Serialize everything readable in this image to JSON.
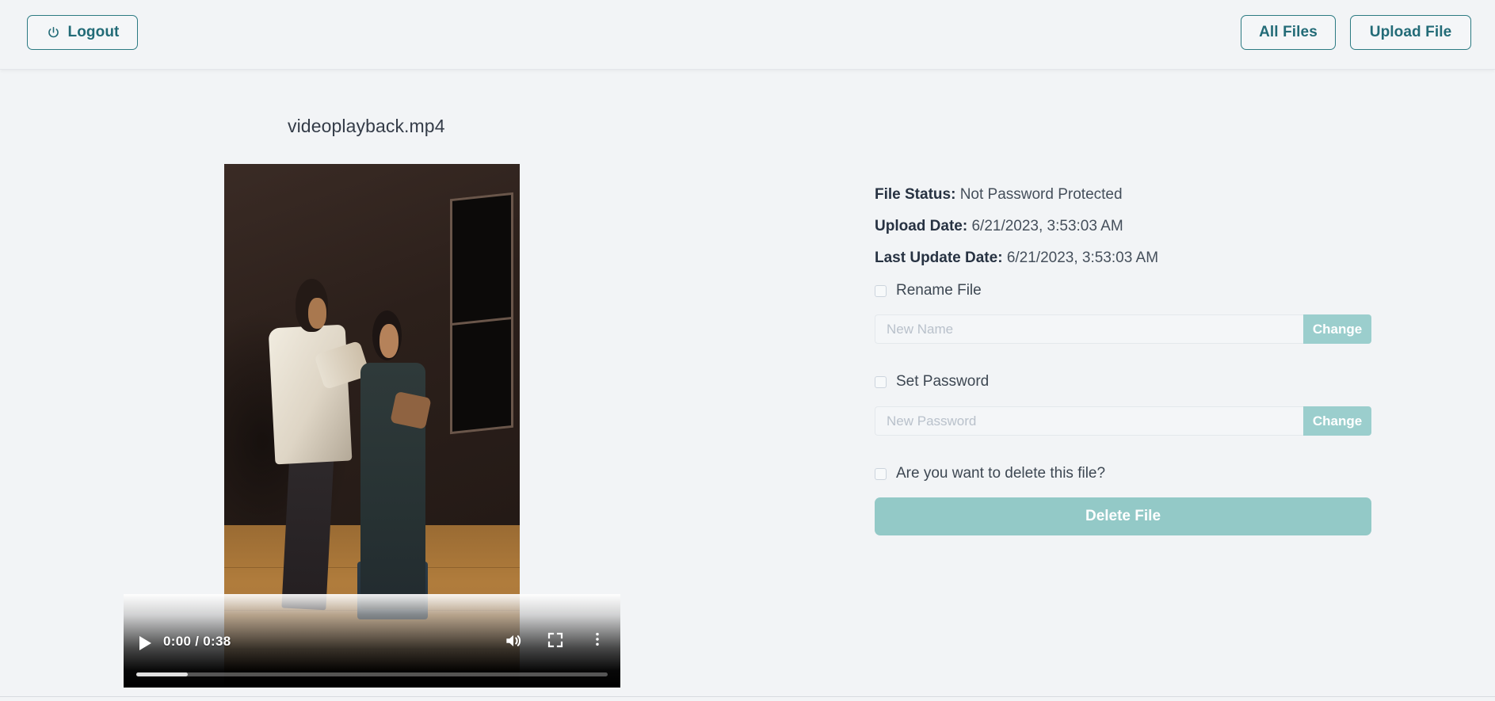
{
  "header": {
    "logout_label": "Logout",
    "logout_icon": "power-icon",
    "all_files_label": "All Files",
    "upload_file_label": "Upload File"
  },
  "file": {
    "name": "videoplayback.mp4"
  },
  "video": {
    "current_time": "0:00",
    "duration": "0:38",
    "time_display": "0:00 / 0:38",
    "play_icon": "play-icon",
    "volume_icon": "volume-on-icon",
    "fullscreen_icon": "fullscreen-icon",
    "more_options_icon": "kebab-menu-icon",
    "progress_percent": 0,
    "buffered_percent": 11
  },
  "details": {
    "meta": [
      {
        "label": "File Status:",
        "value": "Not Password Protected"
      },
      {
        "label": "Upload Date:",
        "value": "6/21/2023, 3:53:03 AM"
      },
      {
        "label": "Last Update Date:",
        "value": "6/21/2023, 3:53:03 AM"
      }
    ],
    "rename": {
      "checkbox_label": "Rename File",
      "input_value": "",
      "input_placeholder": "New Name",
      "button_label": "Change"
    },
    "password": {
      "checkbox_label": "Set Password",
      "input_value": "",
      "input_placeholder": "New Password",
      "button_label": "Change"
    },
    "delete": {
      "checkbox_label": "Are you want to delete this file?",
      "button_label": "Delete File"
    }
  },
  "colors": {
    "page_background": "#f2f4f6",
    "accent_teal": "#2b7a82",
    "button_muted_teal": "#93c9c7",
    "text_primary": "#2b3440"
  }
}
